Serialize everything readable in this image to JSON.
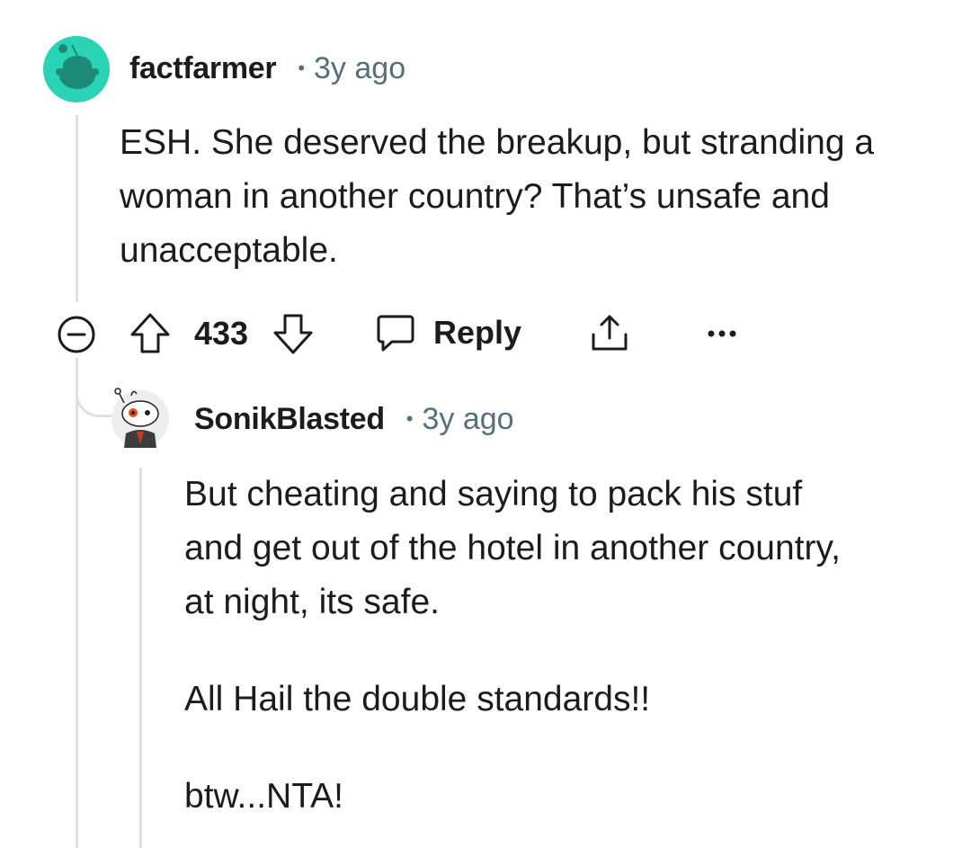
{
  "comments": [
    {
      "username": "factfarmer",
      "separator": "•",
      "time": "3y ago",
      "body": [
        "ESH. She deserved the breakup, but stranding a",
        "woman in another country? That’s unsafe and",
        "unacceptable."
      ],
      "avatar_color": "#2ad3b5",
      "score": "433",
      "reply_label": "Reply",
      "more_label": "•••"
    },
    {
      "username": "SonikBlasted",
      "separator": "•",
      "time": "3y ago",
      "body": [
        "But cheating and saying to pack his stuf",
        "and get out of the hotel in another country,",
        "at night, its safe.",
        "",
        "All Hail the double standards!!",
        "",
        "btw...NTA!"
      ]
    }
  ],
  "icons": [
    "collapse-icon",
    "upvote-icon",
    "downvote-icon",
    "reply-icon",
    "share-icon",
    "more-icon"
  ]
}
